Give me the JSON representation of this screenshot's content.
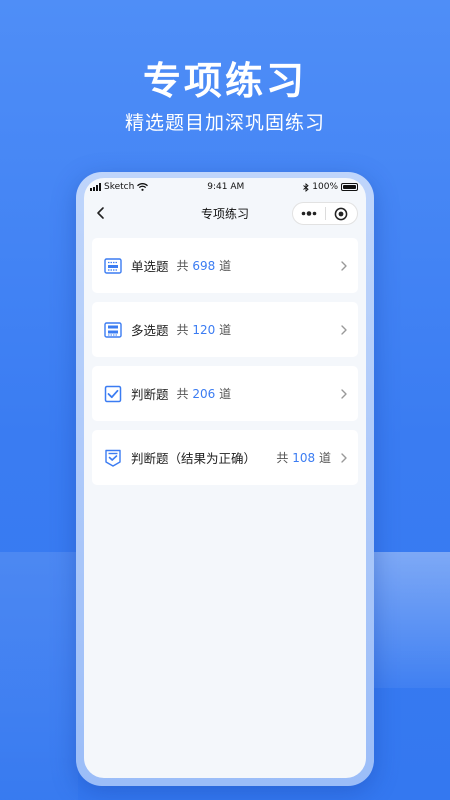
{
  "hero": {
    "title": "专项练习",
    "subtitle": "精选题目加深巩固练习"
  },
  "status_bar": {
    "carrier": "Sketch",
    "time": "9:41 AM",
    "battery": "100%"
  },
  "nav": {
    "title": "专项练习",
    "more_icon": "more-dots-icon",
    "close_icon": "target-circle-icon"
  },
  "items": [
    {
      "name": "单选题",
      "prefix": "共",
      "count": "698",
      "suffix": "道",
      "icon": "single-choice-icon"
    },
    {
      "name": "多选题",
      "prefix": "共",
      "count": "120",
      "suffix": "道",
      "icon": "multi-choice-icon"
    },
    {
      "name": "判断题",
      "prefix": "共",
      "count": "206",
      "suffix": "道",
      "icon": "checkbox-icon"
    },
    {
      "name": "判断题（结果为正确）",
      "prefix": "共",
      "count": "108",
      "suffix": "道",
      "icon": "correct-judgement-icon"
    }
  ],
  "colors": {
    "accent": "#3b7cf2",
    "background": "#4f8ef7"
  }
}
